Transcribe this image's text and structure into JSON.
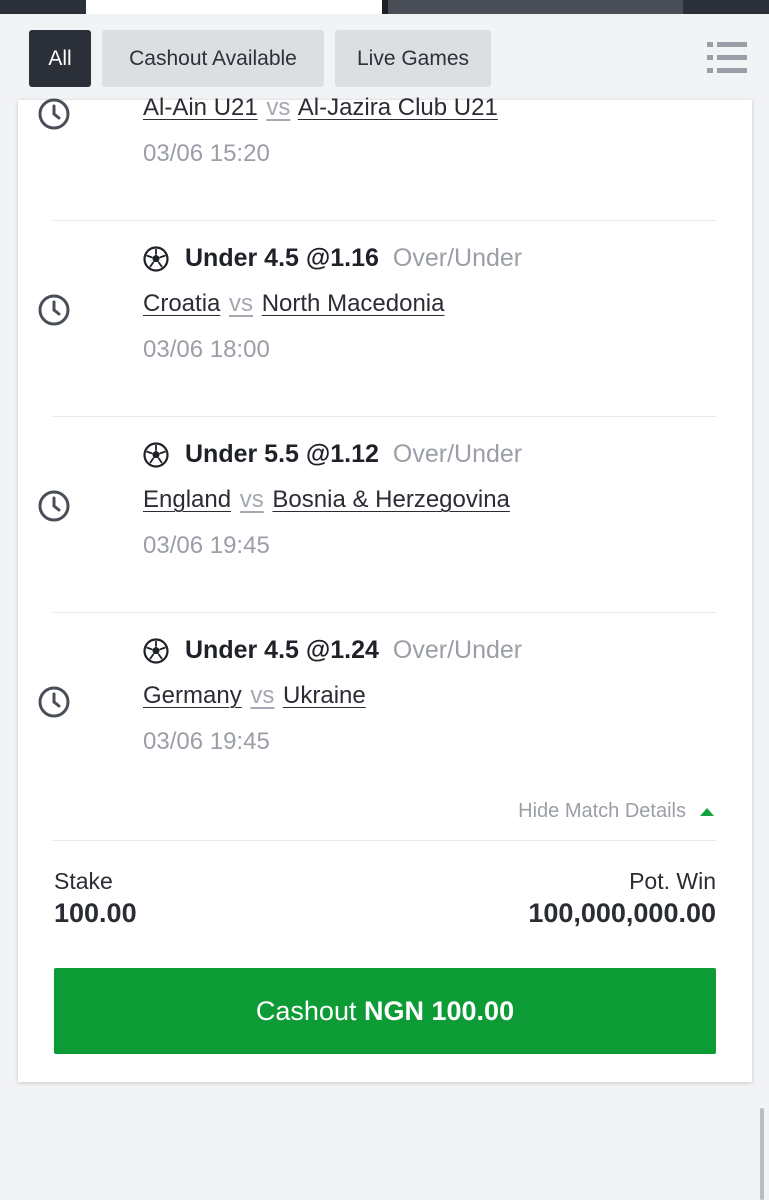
{
  "filters": {
    "all": "All",
    "cashout_available": "Cashout Available",
    "live_games": "Live Games"
  },
  "matches": [
    {
      "pick": null,
      "home": "Al-Ain U21",
      "vs": "vs",
      "away": "Al-Jazira Club U21",
      "datetime": "03/06 15:20"
    },
    {
      "pick": "Under 4.5 @1.16",
      "market": "Over/Under",
      "home": "Croatia",
      "vs": "vs",
      "away": "North Macedonia",
      "datetime": "03/06 18:00"
    },
    {
      "pick": "Under 5.5 @1.12",
      "market": "Over/Under",
      "home": "England",
      "vs": "vs",
      "away": "Bosnia & Herzegovina",
      "datetime": "03/06 19:45"
    },
    {
      "pick": "Under 4.5 @1.24",
      "market": "Over/Under",
      "home": "Germany",
      "vs": "vs",
      "away": "Ukraine",
      "datetime": "03/06 19:45"
    }
  ],
  "details_toggle": "Hide Match Details",
  "stake": {
    "label": "Stake",
    "value": "100.00"
  },
  "pot_win": {
    "label": "Pot. Win",
    "value": "100,000,000.00"
  },
  "cashout": {
    "prefix": "Cashout",
    "amount": "NGN 100.00"
  },
  "colors": {
    "accent_green": "#0d9b35",
    "dark_chip": "#2c3038",
    "light_chip": "#dcdee2"
  },
  "icons": {
    "clock": "clock-icon",
    "ball": "soccer-ball-icon",
    "menu": "list-menu-icon",
    "toggle": "triangle-up-icon"
  }
}
